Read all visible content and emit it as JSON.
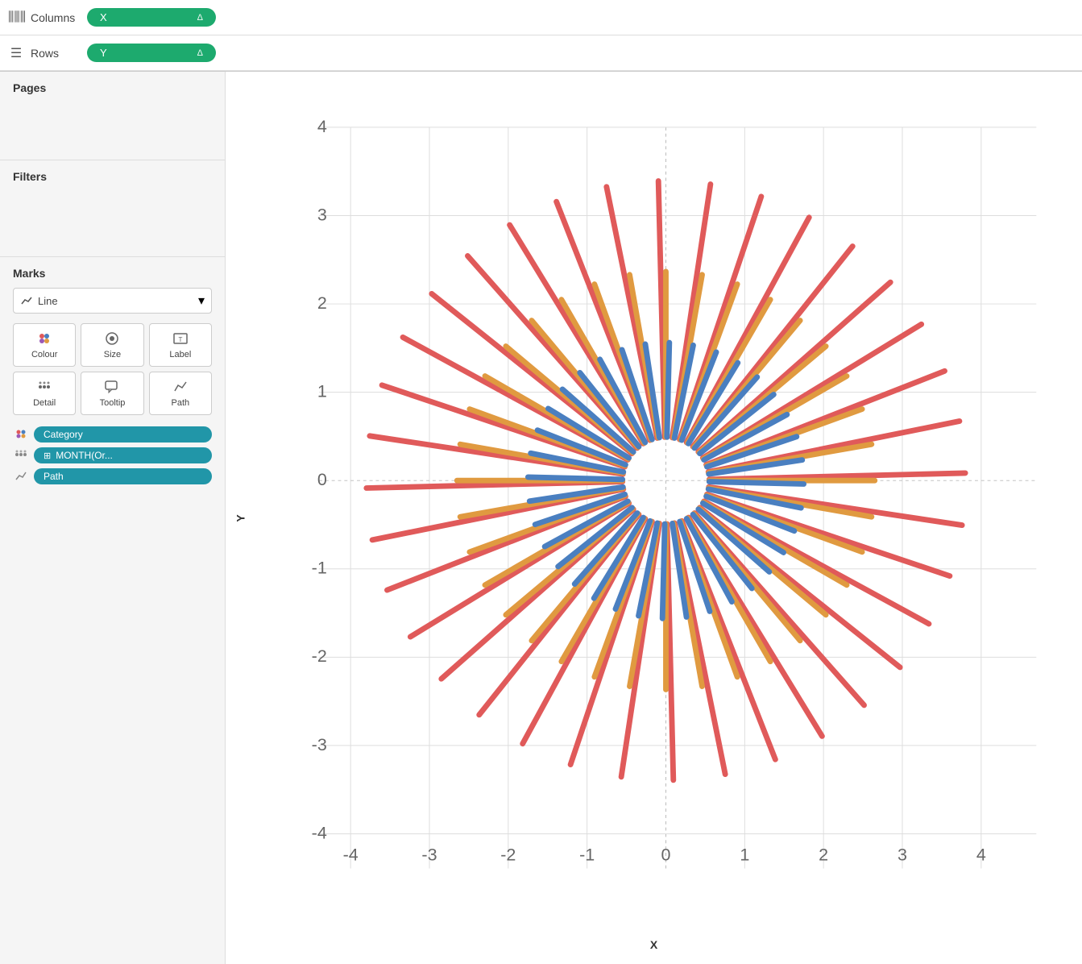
{
  "top": {
    "columns_icon": "|||",
    "columns_label": "Columns",
    "columns_pill_text": "X",
    "columns_pill_delta": "Δ",
    "rows_icon": "≡",
    "rows_label": "Rows",
    "rows_pill_text": "Y",
    "rows_pill_delta": "Δ"
  },
  "left": {
    "pages_title": "Pages",
    "filters_title": "Filters",
    "marks_title": "Marks",
    "marks_type": "Line",
    "mark_buttons": [
      {
        "label": "Colour",
        "icon": "colour"
      },
      {
        "label": "Size",
        "icon": "size"
      },
      {
        "label": "Label",
        "icon": "label"
      },
      {
        "label": "Detail",
        "icon": "detail"
      },
      {
        "label": "Tooltip",
        "icon": "tooltip"
      },
      {
        "label": "Path",
        "icon": "path"
      }
    ],
    "marks_pills": [
      {
        "icon": "colour",
        "text": "Category",
        "has_plus": false
      },
      {
        "icon": "detail",
        "text": "MONTH(Or...",
        "has_plus": true
      },
      {
        "icon": "path",
        "text": "Path",
        "has_plus": false
      }
    ]
  },
  "chart": {
    "x_label": "X",
    "y_label": "Y",
    "x_ticks": [
      "-4",
      "-3",
      "-2",
      "-1",
      "0",
      "1",
      "2",
      "3",
      "4"
    ],
    "y_ticks": [
      "-4",
      "-3",
      "-2",
      "-1",
      "0",
      "1",
      "2",
      "3",
      "4"
    ],
    "colors": {
      "red": "#e05a5a",
      "orange": "#e09a40",
      "blue": "#4a7fc0"
    }
  }
}
